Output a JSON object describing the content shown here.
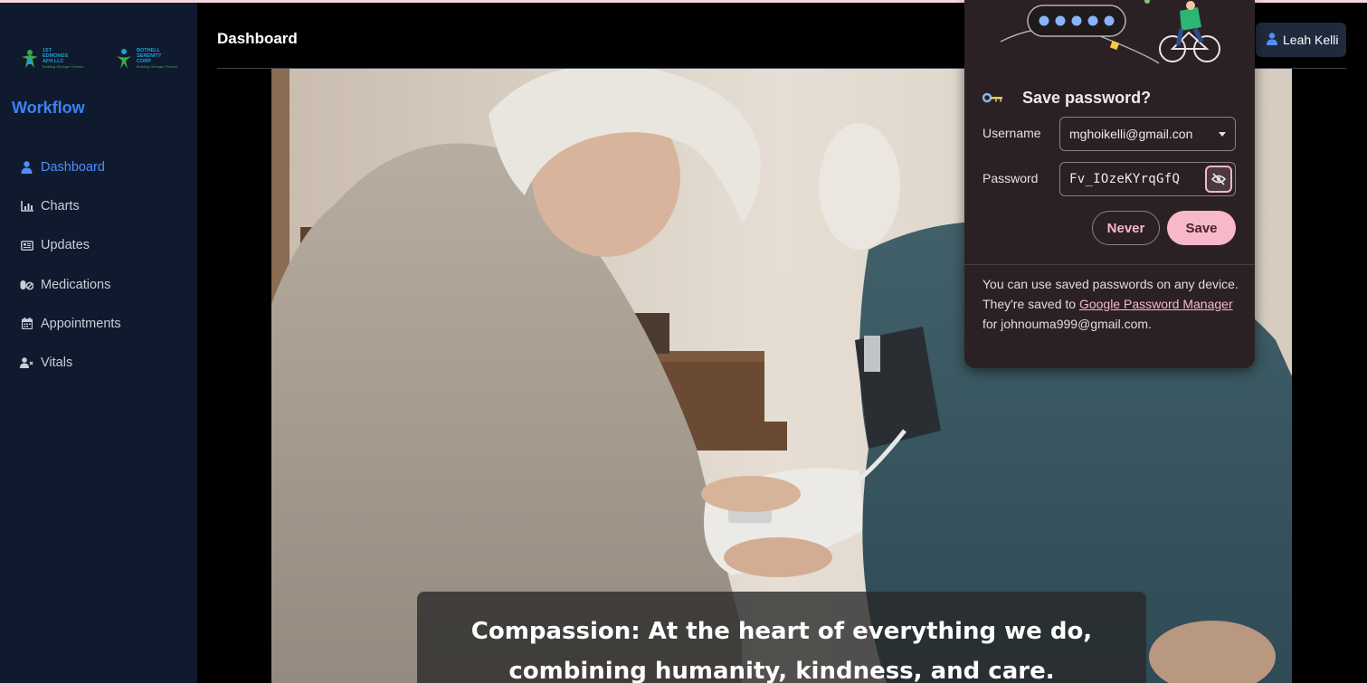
{
  "sidebar": {
    "logos": [
      {
        "line1": "1ST",
        "line2": "EDMONDS",
        "line3": "AFH LLC",
        "tagline": "Building Stronger Futures"
      },
      {
        "line1": "BOTHELL",
        "line2": "SERENITY",
        "line3": "CORP",
        "tagline": "Building Stronger Futures"
      }
    ],
    "brand": "Workflow",
    "items": [
      {
        "label": "Dashboard",
        "icon": "user-icon",
        "active": true
      },
      {
        "label": "Charts",
        "icon": "chart-icon",
        "active": false
      },
      {
        "label": "Updates",
        "icon": "newspaper-icon",
        "active": false
      },
      {
        "label": "Medications",
        "icon": "pills-icon",
        "active": false
      },
      {
        "label": "Appointments",
        "icon": "calendar-icon",
        "active": false
      },
      {
        "label": "Vitals",
        "icon": "user-vitals-icon",
        "active": false
      }
    ]
  },
  "header": {
    "title": "Dashboard",
    "user_name": "Leah Kelli"
  },
  "hero": {
    "caption": "Compassion: At the heart of everything we do, combining humanity, kindness, and care."
  },
  "password_popup": {
    "title": "Save password?",
    "username_label": "Username",
    "username_value": "mghoikelli@gmail.con",
    "password_label": "Password",
    "password_value": "Fv_IOzeKYrqGfQ",
    "never_label": "Never",
    "save_label": "Save",
    "footer_prefix": "You can use saved passwords on any device. They're saved to ",
    "footer_link": "Google Password Manager",
    "footer_suffix": " for johnouma999@gmail.com."
  },
  "colors": {
    "sidebar_bg": "#101a2e",
    "accent_blue": "#3b82f6",
    "popup_bg": "#2b2124",
    "popup_accent": "#f7b8c9"
  }
}
